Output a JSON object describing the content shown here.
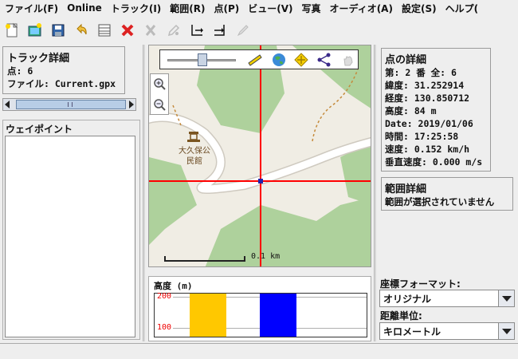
{
  "menubar": {
    "items": [
      "ファイル(F)",
      "Online",
      "トラック(I)",
      "範囲(R)",
      "点(P)",
      "ビュー(V)",
      "写真",
      "オーディオ(A)",
      "設定(S)",
      "ヘルプ("
    ]
  },
  "toolbar": {
    "buttons": [
      "new-icon",
      "open-photo-icon",
      "save-icon",
      "undo-icon",
      "table-icon",
      "delete-icon",
      "cut-icon",
      "edit-icon",
      "axis-icon",
      "axis-arrow-icon",
      "pen-icon"
    ]
  },
  "track_details": {
    "title": "トラック詳細",
    "points": "点: 6",
    "file": "ファイル: Current.gpx"
  },
  "waypoints": {
    "title": "ウェイポイント"
  },
  "map": {
    "poi_name_line1": "大久保公",
    "poi_name_line2": "民館",
    "scale_label": "0.1 km",
    "tools": [
      "slider",
      "ruler-icon",
      "globe-icon",
      "move-icon",
      "connect-icon",
      "hand-icon"
    ]
  },
  "altitude": {
    "title": "高度 (m)",
    "tick_top": "200",
    "tick_bottom": "100",
    "colors": [
      "#ffc800",
      "#0000ff"
    ]
  },
  "point_details": {
    "title": "点の詳細",
    "lines": [
      "第: 2 番 全: 6",
      "緯度: 31.252914",
      "経度: 130.850712",
      "高度: 84 m",
      "Date: 2019/01/06",
      "時間: 17:25:58",
      "速度: 0.152 km/h",
      "垂直速度: 0.000 m/s"
    ]
  },
  "range_details": {
    "title": "範囲詳細",
    "message": "範囲が選択されていません"
  },
  "coord_format": {
    "label": "座標フォーマット:",
    "value": "オリジナル"
  },
  "distance_unit": {
    "label": "距離単位:",
    "value": "キロメートル"
  }
}
